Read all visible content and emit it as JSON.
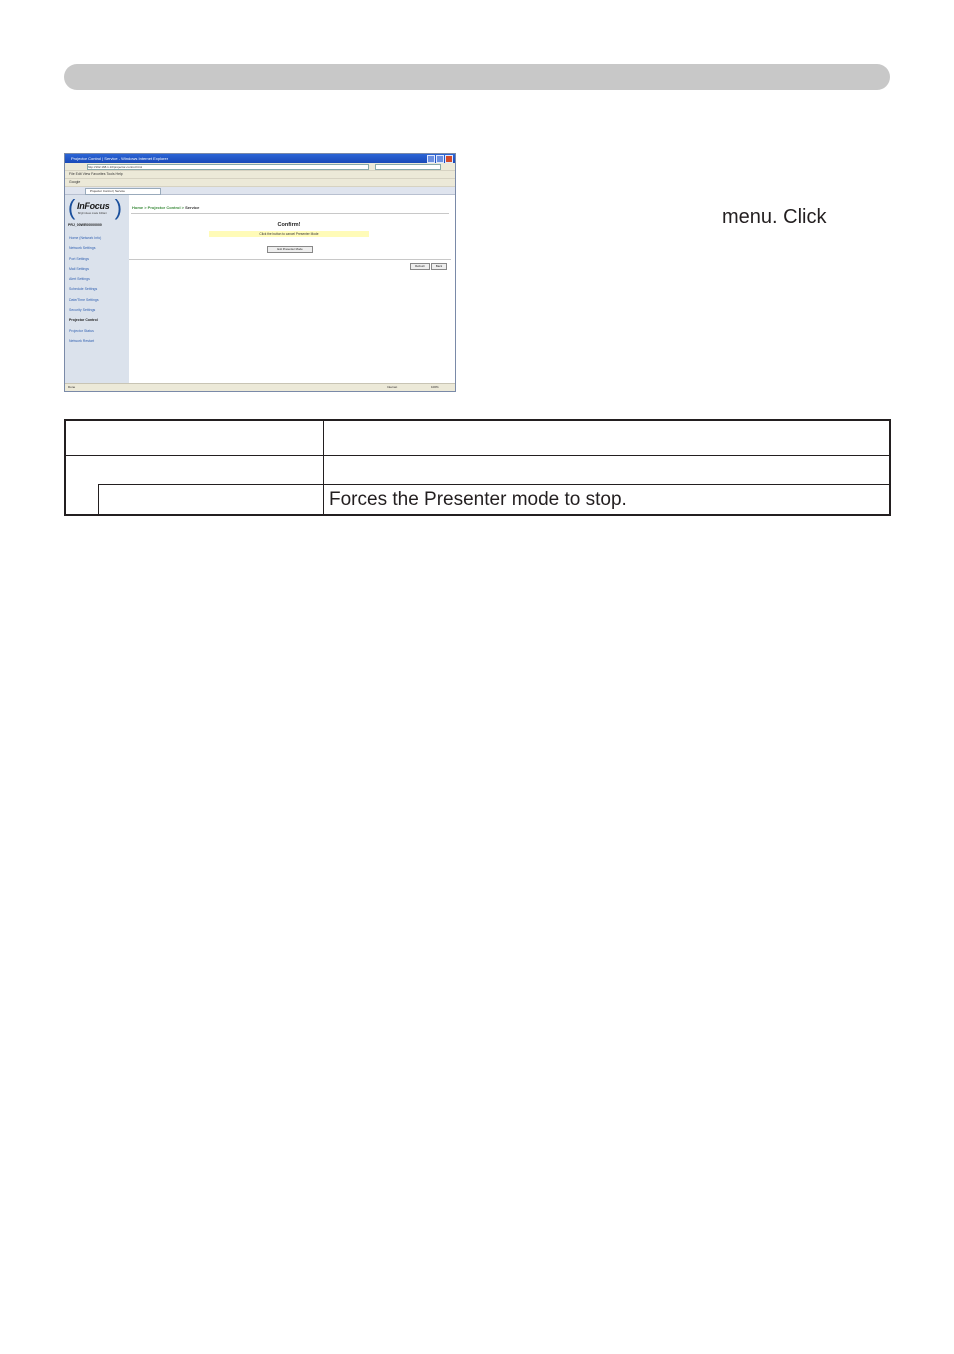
{
  "side_text": "menu. Click",
  "browser": {
    "window_title": "Projector Control | Service - Windows Internet Explorer",
    "menu": "File   Edit   View   Favorites   Tools   Help",
    "address": "http://192.168.1.10/projector-control.html",
    "toolbar": "Google",
    "tab_label": "Projector Control | Service",
    "logo": "InFocus",
    "logo_tagline": "Bright ideas made brilliant",
    "projector_name": "PRJ_00WE00000000",
    "nav_items": [
      "Home (Network Info)",
      "Network Settings",
      "Port Settings",
      "Mail Settings",
      "Alert Settings",
      "Schedule Settings",
      "Date/Time Settings",
      "Security Settings",
      "Projector Control",
      "Projector Status",
      "Network Restart"
    ],
    "active_nav": "Projector Control",
    "breadcrumb_links": "Home > Projector Control >",
    "breadcrumb_current": " Service",
    "confirm_title": "Confirm!",
    "notice": "Click the button to cancel Presenter Mode",
    "exit_button": "Exit Presenter Mode",
    "refresh_button": "Refresh",
    "back_button": "Back",
    "status_left": "Done",
    "status_zone": "Internet",
    "status_zoom": "100%"
  },
  "table": {
    "header": [
      "",
      ""
    ],
    "rows": [
      {
        "item": "",
        "description": ""
      },
      {
        "item": "",
        "description": "Forces the Presenter mode to stop."
      }
    ]
  }
}
